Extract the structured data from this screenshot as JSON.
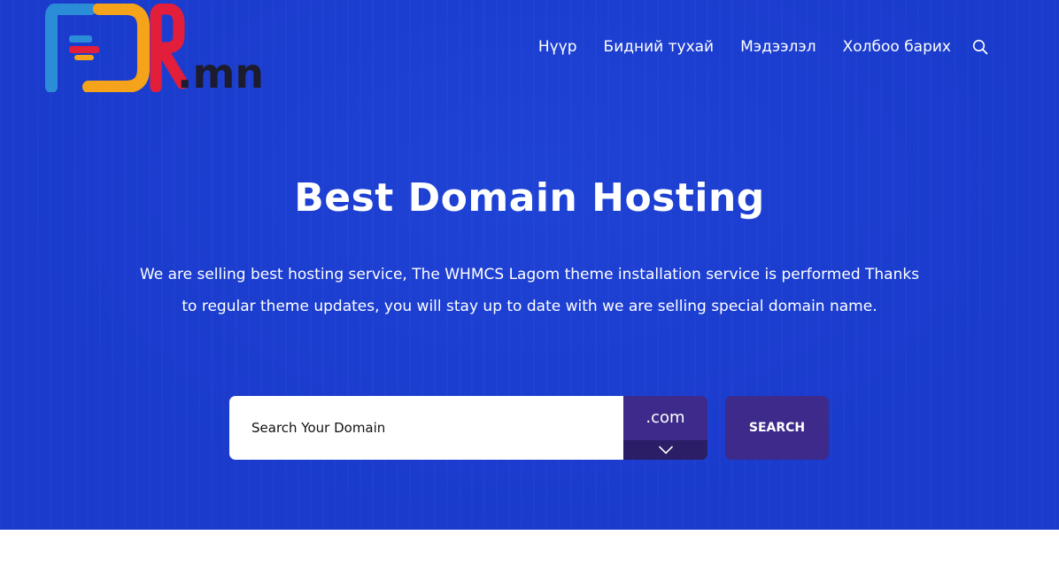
{
  "logo": {
    "text": ".mn",
    "colors": {
      "blue": "#2b8cd8",
      "orange": "#f5a31a",
      "red": "#e31e3a",
      "dark": "#1c1c2e"
    }
  },
  "nav": {
    "items": [
      {
        "label": "Нүүр"
      },
      {
        "label": "Бидний тухай"
      },
      {
        "label": "Мэдээлэл"
      },
      {
        "label": "Холбоо барих"
      }
    ],
    "search_icon": "search-icon"
  },
  "hero": {
    "title": "Best Domain Hosting",
    "description": "We are selling best hosting service, The WHMCS Lagom theme installation service is performed Thanks to regular theme updates, you will stay up to date with we are selling special domain name.",
    "background_color": "#1a3bcc"
  },
  "domain_search": {
    "placeholder": "Search Your Domain",
    "value": "",
    "tld_selected": ".com",
    "button_label": "SEARCH",
    "accent_color": "#3d2a8a"
  }
}
